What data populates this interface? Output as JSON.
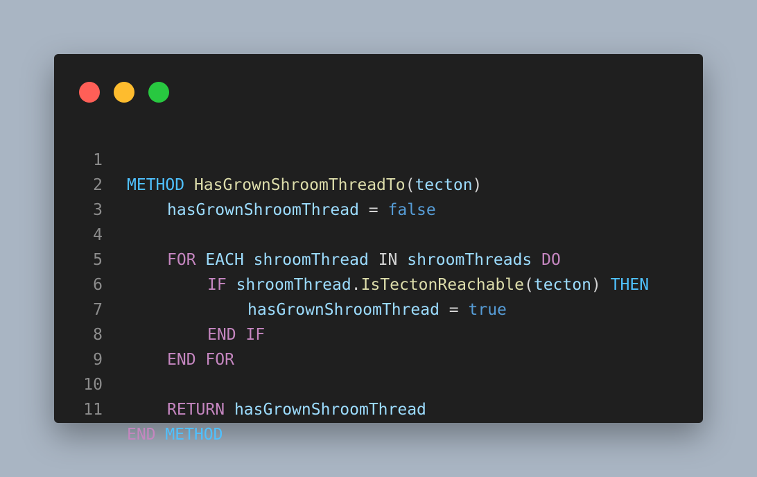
{
  "colors": {
    "background": "#a9b5c3",
    "window": "#1f1f1f",
    "close": "#ff5f57",
    "minimize": "#febc2e",
    "maximize": "#28c840",
    "line_number": "#8c8c8c",
    "keyword": "#c586c0",
    "type": "#4fc1ff",
    "function": "#dcdcaa",
    "variable": "#9cdcfe",
    "literal": "#569cd6",
    "plain": "#d4d4d4"
  },
  "code": {
    "lines": [
      {
        "num": "1",
        "tokens": [
          "METHOD",
          " ",
          "HasGrownShroomThreadTo",
          "(",
          "tecton",
          ")"
        ]
      },
      {
        "num": "2",
        "tokens": [
          "hasGrownShroomThread",
          " = ",
          "false"
        ]
      },
      {
        "num": "3",
        "tokens": []
      },
      {
        "num": "4",
        "tokens": [
          "FOR",
          " ",
          "EACH",
          " ",
          "shroomThread",
          " ",
          "IN",
          " ",
          "shroomThreads",
          " ",
          "DO"
        ]
      },
      {
        "num": "5",
        "tokens": [
          "IF",
          " ",
          "shroomThread",
          ".",
          "IsTectonReachable",
          "(",
          "tecton",
          ") ",
          "THEN"
        ]
      },
      {
        "num": "6",
        "tokens": [
          "hasGrownShroomThread",
          " = ",
          "true"
        ]
      },
      {
        "num": "7",
        "tokens": [
          "END",
          " ",
          "IF"
        ]
      },
      {
        "num": "8",
        "tokens": [
          "END",
          " ",
          "FOR"
        ]
      },
      {
        "num": "9",
        "tokens": []
      },
      {
        "num": "10",
        "tokens": [
          "RETURN",
          " ",
          "hasGrownShroomThread"
        ]
      },
      {
        "num": "11",
        "tokens": [
          "END",
          " ",
          "METHOD"
        ]
      }
    ]
  }
}
